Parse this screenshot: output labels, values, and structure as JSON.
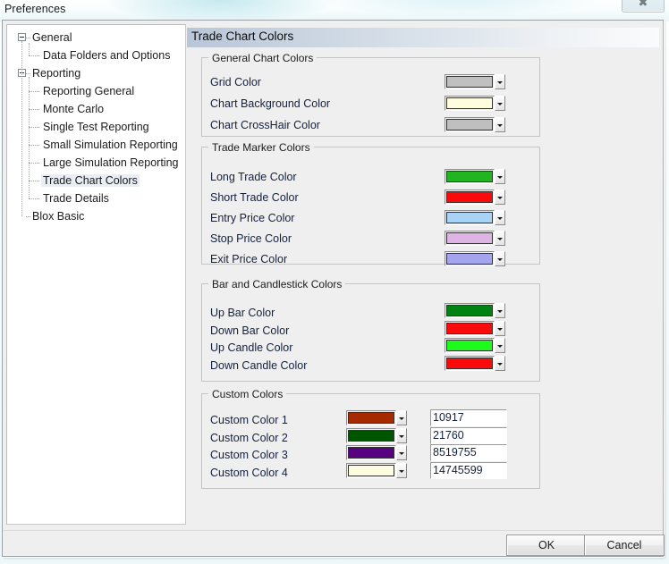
{
  "window": {
    "title": "Preferences",
    "close_icon": "close-icon",
    "close_glyph": "✖"
  },
  "tree": {
    "nodes": [
      {
        "label": "General",
        "depth": 0,
        "expander": "collapse-box",
        "selected": false
      },
      {
        "label": "Data Folders and Options",
        "depth": 1,
        "expander": "",
        "selected": false
      },
      {
        "label": "Reporting",
        "depth": 0,
        "expander": "collapse-box",
        "selected": false
      },
      {
        "label": "Reporting General",
        "depth": 1,
        "expander": "",
        "selected": false
      },
      {
        "label": "Monte Carlo",
        "depth": 1,
        "expander": "",
        "selected": false
      },
      {
        "label": "Single Test Reporting",
        "depth": 1,
        "expander": "",
        "selected": false
      },
      {
        "label": "Small Simulation Reporting",
        "depth": 1,
        "expander": "",
        "selected": false
      },
      {
        "label": "Large Simulation Reporting",
        "depth": 1,
        "expander": "",
        "selected": false
      },
      {
        "label": "Trade Chart Colors",
        "depth": 1,
        "expander": "",
        "selected": true
      },
      {
        "label": "Trade Details",
        "depth": 1,
        "expander": "",
        "selected": false
      },
      {
        "label": "Blox Basic",
        "depth": 0,
        "expander": "",
        "selected": false
      }
    ]
  },
  "pane": {
    "header": "Trade Chart Colors",
    "groups": {
      "general": {
        "legend": "General Chart Colors",
        "rows": [
          {
            "label": "Grid Color",
            "color": "#c0c0c0"
          },
          {
            "label": "Chart Background Color",
            "color": "#fffdde"
          },
          {
            "label": "Chart CrossHair Color",
            "color": "#bfbfbf"
          }
        ]
      },
      "marker": {
        "legend": "Trade Marker Colors",
        "rows": [
          {
            "label": "Long Trade Color",
            "color": "#22b522"
          },
          {
            "label": "Short Trade Color",
            "color": "#fa0a0a"
          },
          {
            "label": "Entry Price Color",
            "color": "#a8d3f5"
          },
          {
            "label": "Stop Price Color",
            "color": "#ddb4e4"
          },
          {
            "label": "Exit Price Color",
            "color": "#a5a5ef"
          }
        ]
      },
      "bar": {
        "legend": "Bar and Candlestick Colors",
        "rows": [
          {
            "label": "Up Bar Color",
            "color": "#008313"
          },
          {
            "label": "Down Bar Color",
            "color": "#fa0a0a"
          },
          {
            "label": "Up Candle Color",
            "color": "#1dfb1d"
          },
          {
            "label": "Down Candle Color",
            "color": "#fa0a0a"
          }
        ]
      },
      "custom": {
        "legend": "Custom Colors",
        "rows": [
          {
            "label": "Custom Color 1",
            "color": "#a52a00",
            "value": "10917"
          },
          {
            "label": "Custom Color 2",
            "color": "#005500",
            "value": "21760"
          },
          {
            "label": "Custom Color 3",
            "color": "#570082",
            "value": "8519755"
          },
          {
            "label": "Custom Color 4",
            "color": "#fffddf",
            "value": "14745599"
          }
        ]
      }
    }
  },
  "buttons": {
    "ok": "OK",
    "cancel": "Cancel"
  }
}
